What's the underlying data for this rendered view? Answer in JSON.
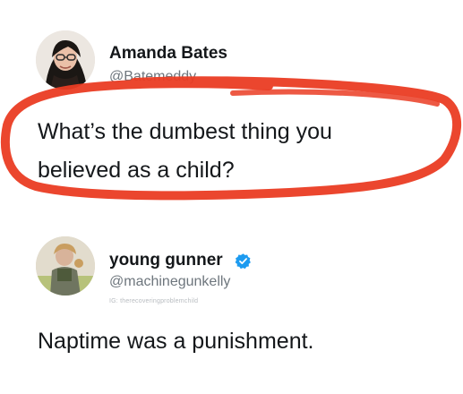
{
  "posts": [
    {
      "display_name": "Amanda Bates",
      "handle": "@Batemeddy",
      "text_line1": "What’s the dumbest thing you",
      "text_line2": "believed as a child?",
      "avatar_icon": "profile-photo-icon"
    },
    {
      "display_name": "young gunner",
      "handle": "@machinegunkelly",
      "verified": true,
      "verified_icon": "verified-badge-icon",
      "credit": "IG: therecoveringproblemchild",
      "text_line1": "Naptime was a punishment.",
      "avatar_icon": "profile-photo-icon"
    }
  ],
  "annotation": {
    "type": "hand-drawn circle",
    "color": "#ea3c23"
  },
  "colors": {
    "verified_blue": "#1d9bf0",
    "handle_gray": "#6e767d",
    "text": "#14171a"
  }
}
